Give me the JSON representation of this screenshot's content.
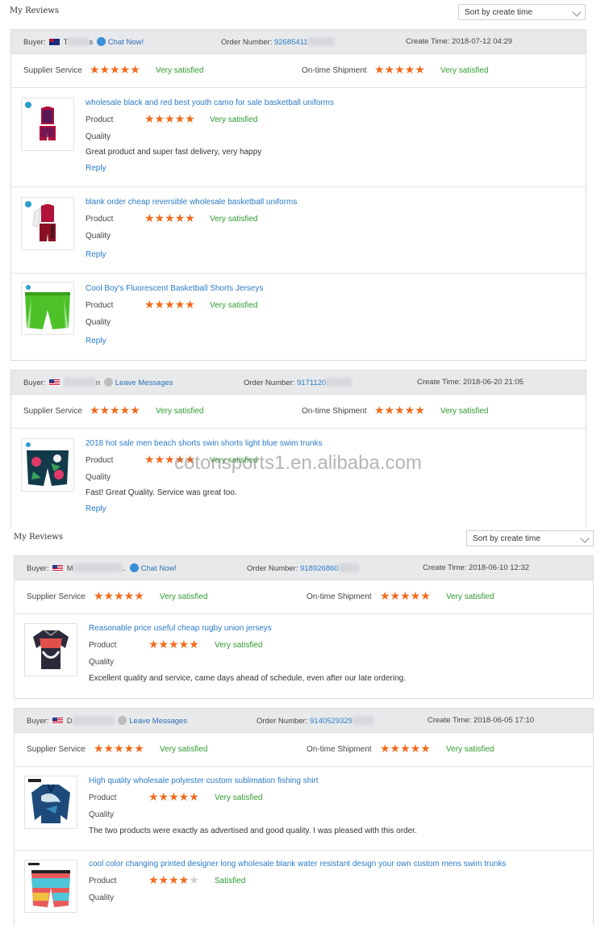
{
  "section1": {
    "heading": "My Reviews",
    "sort_label": "Sort by create time",
    "cards": [
      {
        "buyer_label": "Buyer:",
        "buyer_name": "T",
        "buyer_suffix": "s",
        "contact": "Chat Now!",
        "order_label": "Order Number:",
        "order_number": "92685411",
        "time_label": "Create Time:",
        "create_time": "2018-07-12 04:29",
        "supplier_label": "Supplier Service",
        "supplier_stars": "★★★★★",
        "supplier_rating": "Very satisfied",
        "shipment_label": "On-time Shipment",
        "shipment_stars": "★★★★★",
        "shipment_rating": "Very satisfied",
        "items": [
          {
            "title": "wholesale black and red best youth camo for sale basketball uniforms",
            "product_label": "Product",
            "stars": "★★★★★",
            "rating": "Very satisfied",
            "quality_label": "Quality",
            "comment": "Great product and super fast delivery, very happy",
            "reply": "Reply"
          },
          {
            "title": "blank order cheap reversible wholesale basketball uniforms",
            "product_label": "Product",
            "stars": "★★★★★",
            "rating": "Very satisfied",
            "quality_label": "Quality",
            "comment": "",
            "reply": "Reply"
          },
          {
            "title": "Cool Boy's Fluorescent Basketball Shorts Jerseys",
            "product_label": "Product",
            "stars": "★★★★★",
            "rating": "Very satisfied",
            "quality_label": "Quality",
            "comment": "",
            "reply": "Reply"
          }
        ]
      },
      {
        "buyer_label": "Buyer:",
        "buyer_name": "",
        "buyer_suffix": "n",
        "contact": "Leave Messages",
        "order_label": "Order Number:",
        "order_number": "9171120",
        "time_label": "Create Time:",
        "create_time": "2018-06-20 21:05",
        "supplier_label": "Supplier Service",
        "supplier_stars": "★★★★★",
        "supplier_rating": "Very satisfied",
        "shipment_label": "On-time Shipment",
        "shipment_stars": "★★★★★",
        "shipment_rating": "Very satisfied",
        "items": [
          {
            "title": "2018 hot sale men beach shorts swin shorts light blue swim trunks",
            "product_label": "Product",
            "stars": "★★★★★",
            "rating": "Very satisfied",
            "quality_label": "Quality",
            "comment": "Fast! Great Quality. Service was great too.",
            "reply": "Reply"
          }
        ]
      }
    ],
    "watermark": "cotonsports1.en.alibaba.com"
  },
  "section2": {
    "heading": "My Reviews",
    "sort_label": "Sort by create time",
    "cards": [
      {
        "buyer_label": "Buyer:",
        "buyer_name": "M",
        "buyer_suffix": "..",
        "contact": "Chat Now!",
        "order_label": "Order Number:",
        "order_number": "918926860",
        "time_label": "Create Time:",
        "create_time": "2018-06-10 12:32",
        "supplier_label": "Supplier Service",
        "supplier_stars": "★★★★★",
        "supplier_rating": "Very satisfied",
        "shipment_label": "On-time Shipment",
        "shipment_stars": "★★★★★",
        "shipment_rating": "Very satisfied",
        "items": [
          {
            "title": "Reasonable price useful cheap rugby union jerseys",
            "product_label": "Product",
            "stars": "★★★★★",
            "rating": "Very satisfied",
            "quality_label": "Quality",
            "comment": "Excellent quality and service, came days ahead of schedule, even after our late ordering.",
            "reply": ""
          }
        ]
      },
      {
        "buyer_label": "Buyer:",
        "buyer_name": "D",
        "buyer_suffix": "",
        "contact": "Leave Messages",
        "order_label": "Order Number:",
        "order_number": "9140529329",
        "time_label": "Create Time:",
        "create_time": "2018-06-05 17:10",
        "supplier_label": "Supplier Service",
        "supplier_stars": "★★★★★",
        "supplier_rating": "Very satisfied",
        "shipment_label": "On-time Shipment",
        "shipment_stars": "★★★★★",
        "shipment_rating": "Very satisfied",
        "items": [
          {
            "title": "High quality wholesale polyester custom sublimation fishing shirt",
            "product_label": "Product",
            "stars": "★★★★★",
            "rating": "Very satisfied",
            "quality_label": "Quality",
            "comment": "The two products were exactly as advertised and good quality. I was pleased with this order.",
            "reply": ""
          },
          {
            "title": "cool color changing printed designer long wholesale blank water resistant design your own custom mens swim trunks",
            "product_label": "Product",
            "stars": "★★★★",
            "stars_off": "★",
            "rating": "Satisfied",
            "quality_label": "Quality",
            "comment": "",
            "reply": ""
          }
        ]
      }
    ]
  },
  "colors": {
    "star": "#f26a1b",
    "satisfied": "#2f9a2f",
    "link": "#2b7bc8",
    "header_bg": "#e8e9eb"
  },
  "icons": [
    "chat-icon",
    "message-icon",
    "flag-au-icon",
    "flag-us-icon",
    "chevron-down-icon"
  ]
}
